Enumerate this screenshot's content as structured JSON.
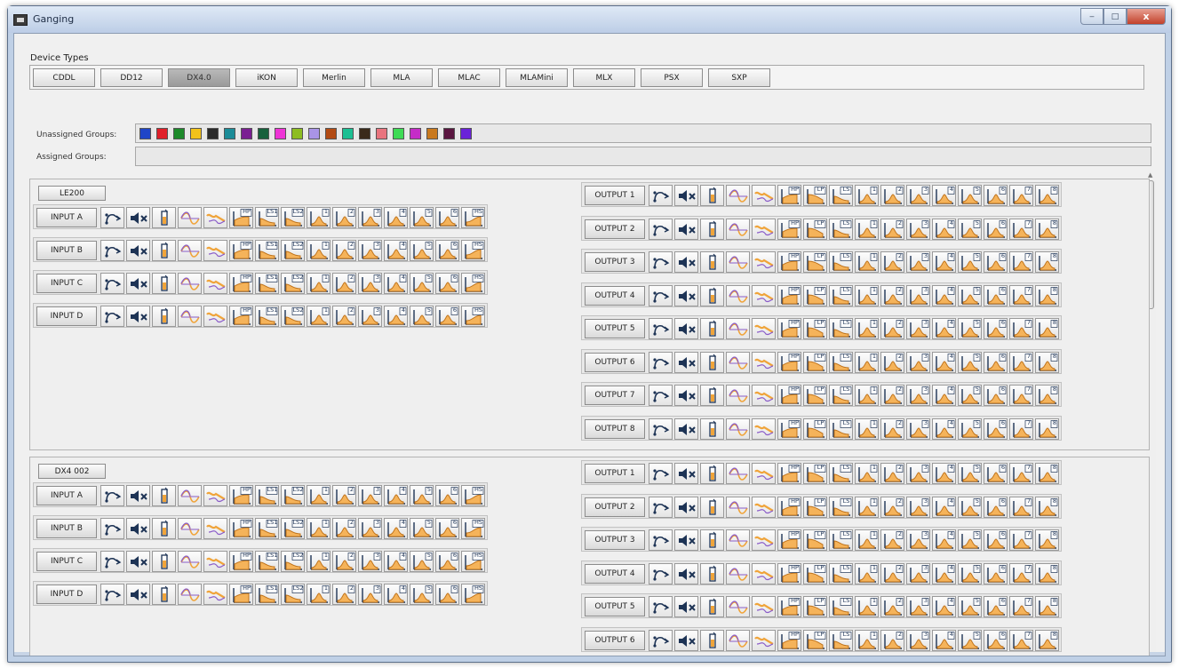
{
  "window": {
    "title": "Ganging"
  },
  "title_buttons": {
    "minimize": "‒",
    "maximize": "□",
    "close": "x"
  },
  "device_types": {
    "label": "Device Types",
    "items": [
      "CDDL",
      "DD12",
      "DX4.0",
      "iKON",
      "Merlin",
      "MLA",
      "MLAC",
      "MLAMini",
      "MLX",
      "PSX",
      "SXP"
    ],
    "selected": "DX4.0"
  },
  "groups": {
    "unassigned_label": "Unassigned Groups:",
    "assigned_label": "Assigned Groups:",
    "colors": [
      "#1f45c8",
      "#e0202a",
      "#1d8a2a",
      "#f2c21a",
      "#2b2b2b",
      "#1c8c98",
      "#7a1f92",
      "#17613c",
      "#ee34d6",
      "#8dbd22",
      "#a994e6",
      "#b24b14",
      "#1bbf93",
      "#3a2a1a",
      "#e8747e",
      "#3edb55",
      "#c52cc8",
      "#c9791e",
      "#5a1640",
      "#6a22d8"
    ]
  },
  "icons": {
    "input": [
      "polarity-icon",
      "mute-icon",
      "gain-icon",
      "delay-icon",
      "allpass-icon",
      "hp-filter-icon",
      "ls1-filter-icon",
      "ls2-filter-icon",
      "peq1-icon",
      "peq2-icon",
      "peq3-icon",
      "peq4-icon",
      "peq5-icon",
      "peq6-icon",
      "hs-filter-icon"
    ],
    "output": [
      "polarity-icon",
      "mute-icon",
      "gain-icon",
      "delay-icon",
      "allpass-icon",
      "hp-filter-icon",
      "lp-filter-icon",
      "ls-filter-icon",
      "peq1-icon",
      "peq2-icon",
      "peq3-icon",
      "peq4-icon",
      "peq5-icon",
      "peq6-icon",
      "peq7-icon",
      "peq8-icon"
    ]
  },
  "filter_tags": {
    "input": [
      "HP",
      "LS1",
      "LS2",
      "1",
      "2",
      "3",
      "4",
      "5",
      "6",
      "HS"
    ],
    "output": [
      "HP",
      "LP",
      "LS",
      "1",
      "2",
      "3",
      "4",
      "5",
      "6",
      "7",
      "8"
    ]
  },
  "devices": [
    {
      "name": "LE200",
      "inputs": [
        "INPUT A",
        "INPUT B",
        "INPUT C",
        "INPUT D"
      ],
      "outputs": [
        "OUTPUT 1",
        "OUTPUT 2",
        "OUTPUT 3",
        "OUTPUT 4",
        "OUTPUT 5",
        "OUTPUT 6",
        "OUTPUT 7",
        "OUTPUT 8"
      ]
    },
    {
      "name": "DX4 002",
      "inputs": [
        "INPUT A",
        "INPUT B",
        "INPUT C",
        "INPUT D"
      ],
      "outputs": [
        "OUTPUT 1",
        "OUTPUT 2",
        "OUTPUT 3",
        "OUTPUT 4",
        "OUTPUT 5",
        "OUTPUT 6"
      ]
    }
  ],
  "colors": {
    "accent_orange": "#f0a43a",
    "curve_orange": "#f5b35a",
    "delay_purple": "#8a5cc8",
    "icon_dark": "#1d3355"
  }
}
